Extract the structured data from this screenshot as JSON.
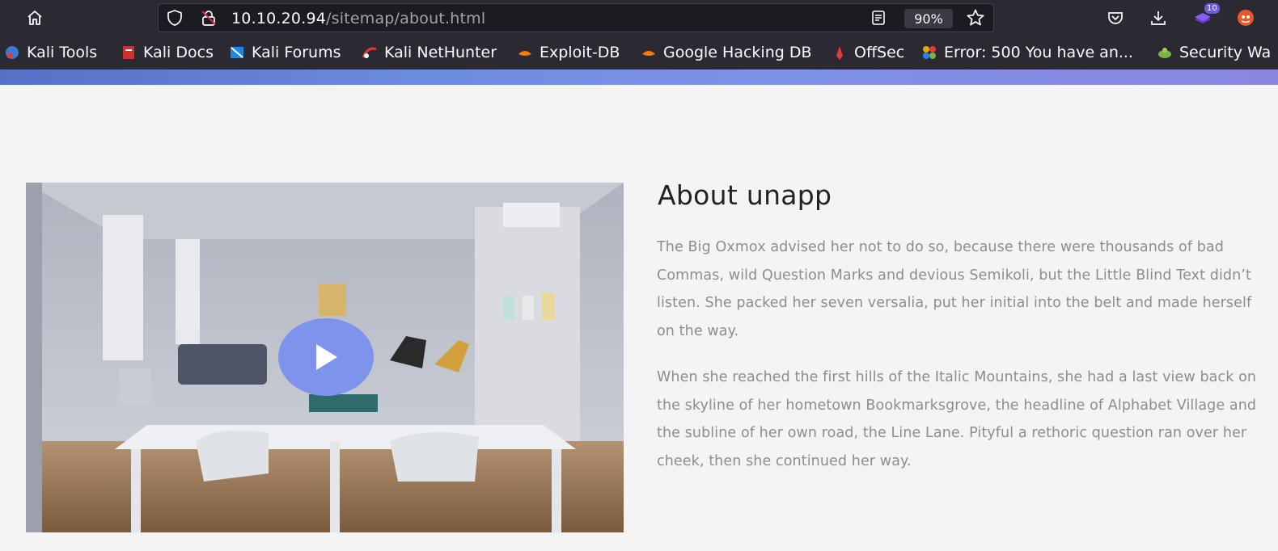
{
  "browser": {
    "url_host": "10.10.20.94",
    "url_path": "/sitemap/about.html",
    "zoom": "90%",
    "extension_badge": "10",
    "icons": [
      "home-icon",
      "shield-icon",
      "lock-warning-icon",
      "reader-view-icon",
      "star-icon",
      "pocket-icon",
      "download-icon",
      "extension-icon",
      "firefox-account-icon"
    ]
  },
  "bookmarks": [
    {
      "label": "Kali Tools",
      "icon": "kali-tools-icon",
      "color": "#3a7bd5"
    },
    {
      "label": "Kali Docs",
      "icon": "kali-docs-icon",
      "color": "#d32f2f"
    },
    {
      "label": "Kali Forums",
      "icon": "kali-forums-icon",
      "color": "#1e88e5"
    },
    {
      "label": "Kali NetHunter",
      "icon": "nethunter-icon",
      "color": "#e53935"
    },
    {
      "label": "Exploit-DB",
      "icon": "exploit-db-icon",
      "color": "#f57c00"
    },
    {
      "label": "Google Hacking DB",
      "icon": "ghdb-icon",
      "color": "#f57c00"
    },
    {
      "label": "OffSec",
      "icon": "offsec-icon",
      "color": "#e53935"
    },
    {
      "label": "Error: 500 You have an...",
      "icon": "joomla-icon",
      "color": "#f0a800"
    },
    {
      "label": "Security Wa",
      "icon": "security-icon",
      "color": "#7cb342"
    }
  ],
  "about": {
    "title": "About unapp",
    "paragraph_1": "The Big Oxmox advised her not to do so, because there were thousands of bad Commas, wild Question Marks and devious Semikoli, but the Little Blind Text didn’t listen. She packed her seven versalia, put her initial into the belt and made herself on the way.",
    "paragraph_2": "When she reached the first hills of the Italic Mountains, she had a last view back on the skyline of her hometown Bookmarksgrove, the headline of Alphabet Village and the subline of her own road, the Line Lane. Pityful a rethoric question ran over her cheek, then she continued her way."
  },
  "colors": {
    "toolbar_bg": "#2b2a33",
    "page_bg": "#f4f4f4",
    "accent": "#7e93eb"
  }
}
